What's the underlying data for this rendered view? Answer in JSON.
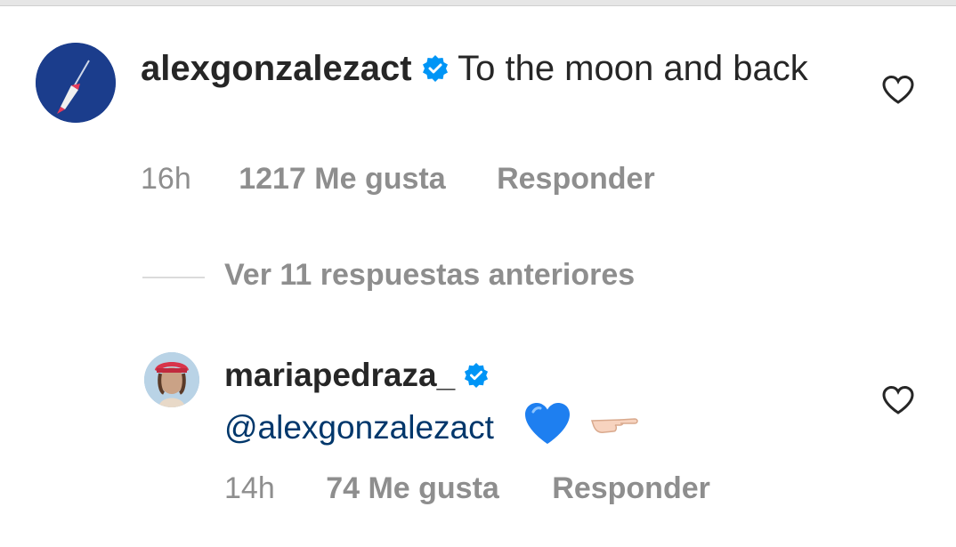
{
  "comments": [
    {
      "username": "alexgonzalezact",
      "verified": true,
      "text": "To the moon and back",
      "time": "16h",
      "likes": "1217 Me gusta",
      "reply": "Responder",
      "avatar_icon": "rocket-icon"
    },
    {
      "username": "mariapedraza_",
      "verified": true,
      "mention": "@alexgonzalezact",
      "emojis": [
        "blue-heart-icon",
        "pointing-hand-icon"
      ],
      "time": "14h",
      "likes": "74 Me gusta",
      "reply": "Responder",
      "avatar_icon": "profile-photo"
    }
  ],
  "view_replies": "Ver 11 respuestas anteriores",
  "colors": {
    "text": "#262626",
    "meta": "#8e8e8e",
    "verified": "#0095f6",
    "mention": "#00376b",
    "avatar1_bg": "#1b3d8c"
  }
}
